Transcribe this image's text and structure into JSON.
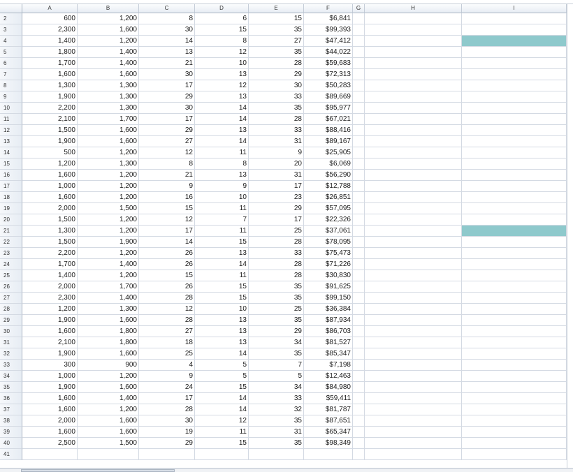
{
  "columns": [
    "A",
    "B",
    "C",
    "D",
    "E",
    "F",
    "G",
    "H",
    "I"
  ],
  "rows": [
    {
      "n": "2",
      "cells": [
        "600",
        "1,200",
        "8",
        "6",
        "15",
        "$6,841"
      ]
    },
    {
      "n": "3",
      "cells": [
        "2,300",
        "1,600",
        "30",
        "15",
        "35",
        "$99,393"
      ]
    },
    {
      "n": "4",
      "cells": [
        "1,400",
        "1,200",
        "14",
        "8",
        "27",
        "$47,412"
      ]
    },
    {
      "n": "5",
      "cells": [
        "1,800",
        "1,400",
        "13",
        "12",
        "35",
        "$44,022"
      ]
    },
    {
      "n": "6",
      "cells": [
        "1,700",
        "1,400",
        "21",
        "10",
        "28",
        "$59,683"
      ]
    },
    {
      "n": "7",
      "cells": [
        "1,600",
        "1,600",
        "30",
        "13",
        "29",
        "$72,313"
      ]
    },
    {
      "n": "8",
      "cells": [
        "1,300",
        "1,300",
        "17",
        "12",
        "30",
        "$50,283"
      ]
    },
    {
      "n": "9",
      "cells": [
        "1,900",
        "1,300",
        "29",
        "13",
        "33",
        "$89,669"
      ]
    },
    {
      "n": "10",
      "cells": [
        "2,200",
        "1,300",
        "30",
        "14",
        "35",
        "$95,977"
      ]
    },
    {
      "n": "11",
      "cells": [
        "2,100",
        "1,700",
        "17",
        "14",
        "28",
        "$67,021"
      ]
    },
    {
      "n": "12",
      "cells": [
        "1,500",
        "1,600",
        "29",
        "13",
        "33",
        "$88,416"
      ]
    },
    {
      "n": "13",
      "cells": [
        "1,900",
        "1,600",
        "27",
        "14",
        "31",
        "$89,167"
      ]
    },
    {
      "n": "14",
      "cells": [
        "500",
        "1,200",
        "12",
        "11",
        "9",
        "$25,905"
      ]
    },
    {
      "n": "15",
      "cells": [
        "1,200",
        "1,300",
        "8",
        "8",
        "20",
        "$6,069"
      ]
    },
    {
      "n": "16",
      "cells": [
        "1,600",
        "1,200",
        "21",
        "13",
        "31",
        "$56,290"
      ]
    },
    {
      "n": "17",
      "cells": [
        "1,000",
        "1,200",
        "9",
        "9",
        "17",
        "$12,788"
      ]
    },
    {
      "n": "18",
      "cells": [
        "1,600",
        "1,200",
        "16",
        "10",
        "23",
        "$26,851"
      ]
    },
    {
      "n": "19",
      "cells": [
        "2,000",
        "1,500",
        "15",
        "11",
        "29",
        "$57,095"
      ]
    },
    {
      "n": "20",
      "cells": [
        "1,500",
        "1,200",
        "12",
        "7",
        "17",
        "$22,326"
      ]
    },
    {
      "n": "21",
      "cells": [
        "1,300",
        "1,200",
        "17",
        "11",
        "25",
        "$37,061"
      ]
    },
    {
      "n": "22",
      "cells": [
        "1,500",
        "1,900",
        "14",
        "15",
        "28",
        "$78,095"
      ]
    },
    {
      "n": "23",
      "cells": [
        "2,200",
        "1,200",
        "26",
        "13",
        "33",
        "$75,473"
      ]
    },
    {
      "n": "24",
      "cells": [
        "1,700",
        "1,400",
        "26",
        "14",
        "28",
        "$71,226"
      ]
    },
    {
      "n": "25",
      "cells": [
        "1,400",
        "1,200",
        "15",
        "11",
        "28",
        "$30,830"
      ]
    },
    {
      "n": "26",
      "cells": [
        "2,000",
        "1,700",
        "26",
        "15",
        "35",
        "$91,625"
      ]
    },
    {
      "n": "27",
      "cells": [
        "2,300",
        "1,400",
        "28",
        "15",
        "35",
        "$99,150"
      ]
    },
    {
      "n": "28",
      "cells": [
        "1,200",
        "1,300",
        "12",
        "10",
        "25",
        "$36,384"
      ]
    },
    {
      "n": "29",
      "cells": [
        "1,900",
        "1,600",
        "28",
        "13",
        "35",
        "$87,934"
      ]
    },
    {
      "n": "30",
      "cells": [
        "1,600",
        "1,800",
        "27",
        "13",
        "29",
        "$86,703"
      ]
    },
    {
      "n": "31",
      "cells": [
        "2,100",
        "1,800",
        "18",
        "13",
        "34",
        "$81,527"
      ]
    },
    {
      "n": "32",
      "cells": [
        "1,900",
        "1,600",
        "25",
        "14",
        "35",
        "$85,347"
      ]
    },
    {
      "n": "33",
      "cells": [
        "300",
        "900",
        "4",
        "5",
        "7",
        "$7,198"
      ]
    },
    {
      "n": "34",
      "cells": [
        "1,000",
        "1,200",
        "9",
        "5",
        "5",
        "$12,463"
      ]
    },
    {
      "n": "35",
      "cells": [
        "1,900",
        "1,600",
        "24",
        "15",
        "34",
        "$84,980"
      ]
    },
    {
      "n": "36",
      "cells": [
        "1,600",
        "1,400",
        "17",
        "14",
        "33",
        "$59,411"
      ]
    },
    {
      "n": "37",
      "cells": [
        "1,600",
        "1,200",
        "28",
        "14",
        "32",
        "$81,787"
      ]
    },
    {
      "n": "38",
      "cells": [
        "2,000",
        "1,600",
        "30",
        "12",
        "35",
        "$87,651"
      ]
    },
    {
      "n": "39",
      "cells": [
        "1,600",
        "1,600",
        "19",
        "11",
        "31",
        "$65,347"
      ]
    },
    {
      "n": "40",
      "cells": [
        "2,500",
        "1,500",
        "29",
        "15",
        "35",
        "$98,349"
      ]
    },
    {
      "n": "41",
      "cells": [
        "",
        "",
        "",
        "",
        "",
        ""
      ]
    }
  ],
  "filled_cells": [
    {
      "row": "4",
      "col": "I",
      "color": "#8ec9cc"
    },
    {
      "row": "21",
      "col": "I",
      "color": "#8ec9cc"
    }
  ]
}
